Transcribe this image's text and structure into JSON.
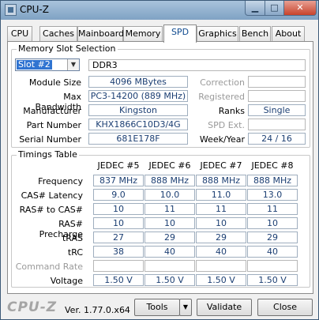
{
  "window": {
    "title": "CPU-Z"
  },
  "tabs": [
    "CPU",
    "Caches",
    "Mainboard",
    "Memory",
    "SPD",
    "Graphics",
    "Bench",
    "About"
  ],
  "active_tab": "SPD",
  "slot_section": {
    "title": "Memory Slot Selection",
    "slot": "Slot #2",
    "type": "DDR3",
    "module_size_label": "Module Size",
    "module_size": "4096 MBytes",
    "max_bandwidth_label": "Max Bandwidth",
    "max_bandwidth": "PC3-14200 (889 MHz)",
    "manufacturer_label": "Manufacturer",
    "manufacturer": "Kingston",
    "part_number_label": "Part Number",
    "part_number": "KHX1866C10D3/4G",
    "serial_number_label": "Serial Number",
    "serial_number": "681E178F",
    "correction_label": "Correction",
    "registered_label": "Registered",
    "ranks_label": "Ranks",
    "ranks": "Single",
    "spd_ext_label": "SPD Ext.",
    "week_year_label": "Week/Year",
    "week_year": "24 / 16"
  },
  "timings": {
    "title": "Timings Table",
    "columns": [
      "JEDEC #5",
      "JEDEC #6",
      "JEDEC #7",
      "JEDEC #8"
    ],
    "rows": [
      {
        "label": "Frequency",
        "values": [
          "837 MHz",
          "888 MHz",
          "888 MHz",
          "888 MHz"
        ]
      },
      {
        "label": "CAS# Latency",
        "values": [
          "9.0",
          "10.0",
          "11.0",
          "13.0"
        ]
      },
      {
        "label": "RAS# to CAS#",
        "values": [
          "10",
          "11",
          "11",
          "11"
        ]
      },
      {
        "label": "RAS# Precharge",
        "values": [
          "10",
          "10",
          "10",
          "10"
        ]
      },
      {
        "label": "tRAS",
        "values": [
          "27",
          "29",
          "29",
          "29"
        ]
      },
      {
        "label": "tRC",
        "values": [
          "38",
          "40",
          "40",
          "40"
        ]
      },
      {
        "label": "Command Rate",
        "values": [
          "",
          "",
          "",
          ""
        ]
      },
      {
        "label": "Voltage",
        "values": [
          "1.50 V",
          "1.50 V",
          "1.50 V",
          "1.50 V"
        ]
      }
    ]
  },
  "footer": {
    "logo": "CPU-Z",
    "version": "Ver. 1.77.0.x64",
    "tools_label": "Tools",
    "validate_label": "Validate",
    "close_label": "Close"
  },
  "colors": {
    "value_text": "#1c3f73",
    "titlebar": "#a9c3dc",
    "close_button": "#c7432c"
  }
}
